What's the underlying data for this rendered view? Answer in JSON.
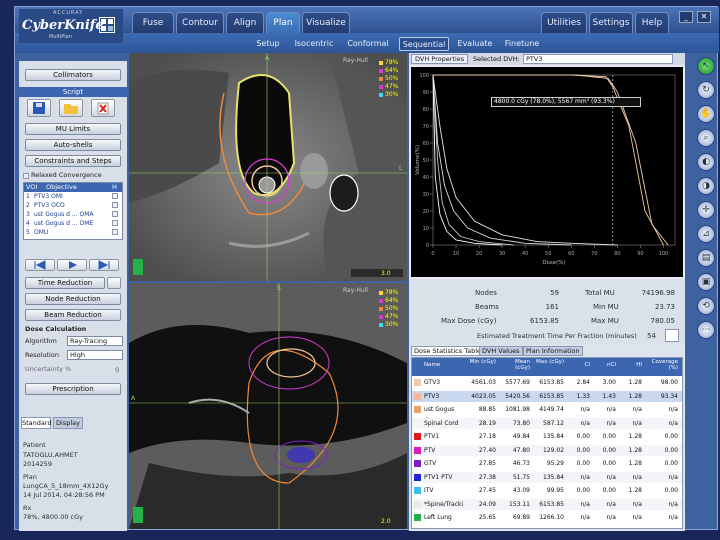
{
  "app": {
    "brand": "CyberKnife",
    "company": "ACCURAY",
    "product": "MultiPlan"
  },
  "tabs": [
    {
      "label": "Fuse",
      "state": "dim"
    },
    {
      "label": "Contour",
      "state": "normal"
    },
    {
      "label": "Align",
      "state": "normal"
    },
    {
      "label": "Plan",
      "state": "active"
    },
    {
      "label": "Visualize",
      "state": "normal"
    }
  ],
  "right_tabs": [
    "Utilities",
    "Settings",
    "Help"
  ],
  "window_controls": {
    "minimize": "_",
    "close": "✕"
  },
  "subtabs": [
    "Setup",
    "Isocentric",
    "Conformal",
    "Sequential",
    "Evaluate",
    "Finetune"
  ],
  "subtab_active": "Sequential",
  "left_panel": {
    "collimators": "Collimators",
    "script_header": "Script",
    "mu_limits": "MU Limits",
    "auto_shells": "Auto-shells",
    "constraints": "Constraints and Steps",
    "relaxed": "Relaxed Convergence",
    "voi_header": {
      "voi": "VOI",
      "objective": "Objective",
      "flag": "H"
    },
    "voi_rows": [
      {
        "n": "1",
        "label": "PTV3  OMI"
      },
      {
        "n": "2",
        "label": "PTV3  OCO"
      },
      {
        "n": "3",
        "label": "ust Gogus d  ... OMA"
      },
      {
        "n": "4",
        "label": "ust Gogus d  ... OME"
      },
      {
        "n": "5",
        "label": "OMU"
      }
    ],
    "time_reduction": "Time Reduction",
    "node_reduction": "Node Reduction",
    "beam_reduction": "Beam Reduction",
    "dose_calc": "Dose Calculation",
    "algorithm_label": "Algorithm",
    "algorithm_value": "Ray-Tracing",
    "resolution_label": "Resolution",
    "resolution_value": "High",
    "uncertainty_label": "Uncertainty %",
    "uncertainty_value": "g",
    "prescription": "Prescription",
    "tab_standard": "Standard",
    "tab_display": "Display",
    "patient_label": "Patient",
    "patient_name": "TATOGLU,AHMET",
    "patient_id": "2014259",
    "plan_label": "Plan",
    "plan_name": "LungCA_5_18mm_4X12Gy",
    "plan_date": "14 Jul 2014, 04:28:56 PM",
    "rx_label": "Rx",
    "rx_value": "78%, 4800.00 cGy"
  },
  "view_top": {
    "orient_top": "A",
    "orient_right": "L",
    "mode": "Ray-Hull",
    "legend": [
      "78%",
      "64%",
      "50%",
      "47%",
      "30%"
    ],
    "scale": "3.0"
  },
  "view_bottom": {
    "orient_top": "S",
    "orient_left": "A",
    "mode": "Ray-Hull",
    "legend": [
      "78%",
      "64%",
      "50%",
      "47%",
      "30%"
    ],
    "scale": "2.0"
  },
  "dvh": {
    "properties_btn": "DVH Properties",
    "selected_label": "Selected DVH:",
    "selected_value": "PTV3",
    "tooltip": "4800.0 cGy (78.0%), 5567 mm³ (93.3%)",
    "ylabel": "Volume (%)",
    "xlabel": "Dose (%)"
  },
  "chart_data": {
    "type": "line",
    "xlabel": "Dose(%)",
    "ylabel": "Volume(%)",
    "xlim": [
      0,
      105
    ],
    "ylim": [
      0,
      100
    ],
    "x_ticks": [
      0,
      10,
      20,
      30,
      40,
      50,
      60,
      70,
      80,
      90,
      100
    ],
    "y_ticks": [
      0,
      10,
      20,
      30,
      40,
      50,
      60,
      70,
      80,
      90,
      100
    ],
    "series": [
      {
        "color": "#f4c79a",
        "x": [
          0,
          60,
          75,
          78,
          85,
          92,
          100
        ],
        "y": [
          100,
          100,
          99,
          93,
          70,
          20,
          0
        ]
      },
      {
        "color": "#f0d0b0",
        "x": [
          0,
          62,
          76,
          80,
          88,
          95,
          102
        ],
        "y": [
          100,
          100,
          98,
          90,
          60,
          12,
          0
        ]
      },
      {
        "color": "#e6e6e6",
        "x": [
          0,
          3,
          6,
          10,
          18,
          30,
          45,
          60,
          80
        ],
        "y": [
          100,
          70,
          45,
          28,
          14,
          6,
          2,
          1,
          0
        ]
      },
      {
        "color": "#dcdcdc",
        "x": [
          0,
          2,
          5,
          9,
          15,
          25,
          40,
          60
        ],
        "y": [
          100,
          60,
          35,
          20,
          10,
          4,
          1,
          0
        ]
      },
      {
        "color": "#c8c8c8",
        "x": [
          0,
          2,
          4,
          7,
          12,
          20,
          35
        ],
        "y": [
          100,
          50,
          25,
          12,
          5,
          2,
          0
        ]
      },
      {
        "color": "#ffffff",
        "x": [
          0,
          1,
          3,
          6,
          10,
          18,
          30
        ],
        "y": [
          100,
          40,
          18,
          8,
          3,
          1,
          0
        ]
      }
    ],
    "marker_x": 78
  },
  "stats": {
    "nodes_label": "Nodes",
    "nodes_value": "59",
    "beams_label": "Beams",
    "beams_value": "161",
    "maxdose_label": "Max Dose (cGy)",
    "maxdose_value": "6153.85",
    "totalmu_label": "Total MU",
    "totalmu_value": "74196.98",
    "minmu_label": "Min MU",
    "minmu_value": "23.73",
    "maxmu_label": "Max MU",
    "maxmu_value": "780.05",
    "time_label": "Estimated Treatment Time Per Fraction (minutes)",
    "time_value": "54"
  },
  "dose_table": {
    "tabs": [
      "Dose Statistics Table",
      "DVH Values",
      "Plan Information"
    ],
    "headers": [
      "Name",
      "Min (cGy)",
      "Mean (cGy)",
      "Max (cGy)",
      "CI",
      "nCI",
      "HI",
      "Coverage (%)"
    ],
    "rows": [
      {
        "color": "#f3c8a4",
        "cells": [
          "GTV3",
          "4561.03",
          "5577.69",
          "6153.85",
          "2.84",
          "3.00",
          "1.28",
          "98.00"
        ]
      },
      {
        "color": "#f3b79a",
        "cells": [
          "PTV3",
          "4023.05",
          "5420.56",
          "6153.85",
          "1.33",
          "1.43",
          "1.28",
          "93.34"
        ]
      },
      {
        "color": "#e7a46a",
        "cells": [
          "ust Gogus dus",
          "88.85",
          "1081.98",
          "4149.74",
          "n/a",
          "n/a",
          "n/a",
          "n/a"
        ]
      },
      {
        "color": "#f2f2f2",
        "cells": [
          "Spinal Cord",
          "28.19",
          "73.80",
          "587.12",
          "n/a",
          "n/a",
          "n/a",
          "n/a"
        ]
      },
      {
        "color": "#e01919",
        "cells": [
          "PTV1",
          "27.18",
          "49.84",
          "135.84",
          "0.00",
          "0.00",
          "1.28",
          "0.00"
        ]
      },
      {
        "color": "#d61fb7",
        "cells": [
          "PTV",
          "27.40",
          "47.80",
          "129.02",
          "0.00",
          "0.00",
          "1.28",
          "0.00"
        ]
      },
      {
        "color": "#7a22c9",
        "cells": [
          "GTV",
          "27.85",
          "46.73",
          "95.29",
          "0.00",
          "0.00",
          "1.28",
          "0.00"
        ]
      },
      {
        "color": "#2323d8",
        "cells": [
          "PTV1 PTV",
          "27.38",
          "51.75",
          "135.84",
          "n/a",
          "n/a",
          "n/a",
          "n/a"
        ]
      },
      {
        "color": "#35c2e6",
        "cells": [
          "ITV",
          "27.45",
          "43.09",
          "99.95",
          "0.00",
          "0.00",
          "1.28",
          "0.00"
        ]
      },
      {
        "color": "#eaeaea",
        "cells": [
          "*Spine/Tracki",
          "24.09",
          "153.11",
          "6153.85",
          "n/a",
          "n/a",
          "n/a",
          "n/a"
        ]
      },
      {
        "color": "#24b14a",
        "cells": [
          "Left Lung",
          "25.65",
          "69.89",
          "1266.10",
          "n/a",
          "n/a",
          "n/a",
          "n/a"
        ]
      }
    ]
  },
  "colors": {
    "accent": "#3c66b0",
    "background": "#18265a"
  }
}
